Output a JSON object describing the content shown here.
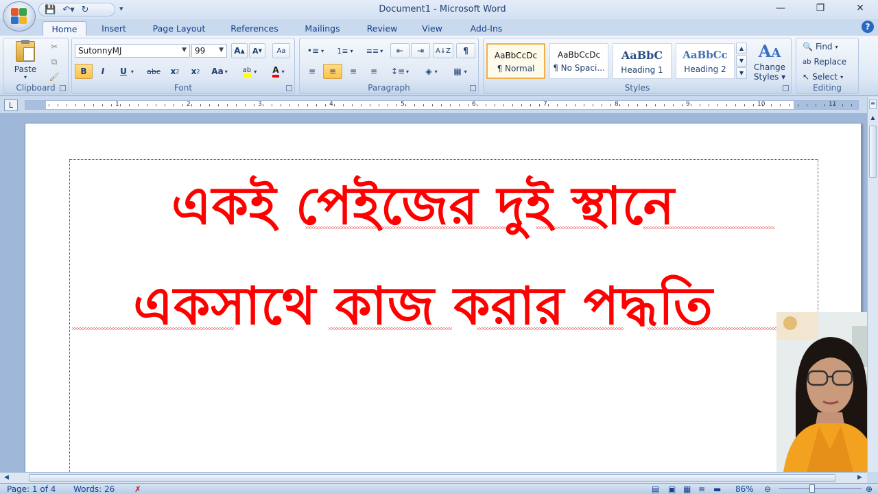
{
  "window": {
    "title": "Document1 - Microsoft Word"
  },
  "tabs": [
    "Home",
    "Insert",
    "Page Layout",
    "References",
    "Mailings",
    "Review",
    "View",
    "Add-Ins"
  ],
  "clipboard": {
    "paste_label": "Paste",
    "group_label": "Clipboard"
  },
  "font": {
    "name": "SutonnyMJ",
    "size": "99",
    "group_label": "Font"
  },
  "paragraph": {
    "group_label": "Paragraph"
  },
  "styles": {
    "items": [
      {
        "preview": "AaBbCcDc",
        "name": "¶ Normal"
      },
      {
        "preview": "AaBbCcDc",
        "name": "¶ No Spaci..."
      },
      {
        "preview": "AaBbC",
        "name": "Heading 1"
      },
      {
        "preview": "AaBbCc",
        "name": "Heading 2"
      }
    ],
    "change_styles_line1": "Change",
    "change_styles_line2": "Styles",
    "group_label": "Styles"
  },
  "editing": {
    "find": "Find",
    "replace": "Replace",
    "select": "Select",
    "group_label": "Editing"
  },
  "ruler": {
    "numbers": [
      "1",
      "2",
      "3",
      "4",
      "5",
      "6",
      "7",
      "8",
      "9",
      "10",
      "11"
    ]
  },
  "document": {
    "line1": "একই পেইজের দুই স্থানে",
    "line2": "একসাথে কাজ করার পদ্ধতি"
  },
  "status": {
    "page": "Page: 1 of 4",
    "words": "Words: 26",
    "zoom": "86%"
  },
  "colors": {
    "text_red": "#ff0000",
    "ribbon": "#dfe9f6"
  }
}
